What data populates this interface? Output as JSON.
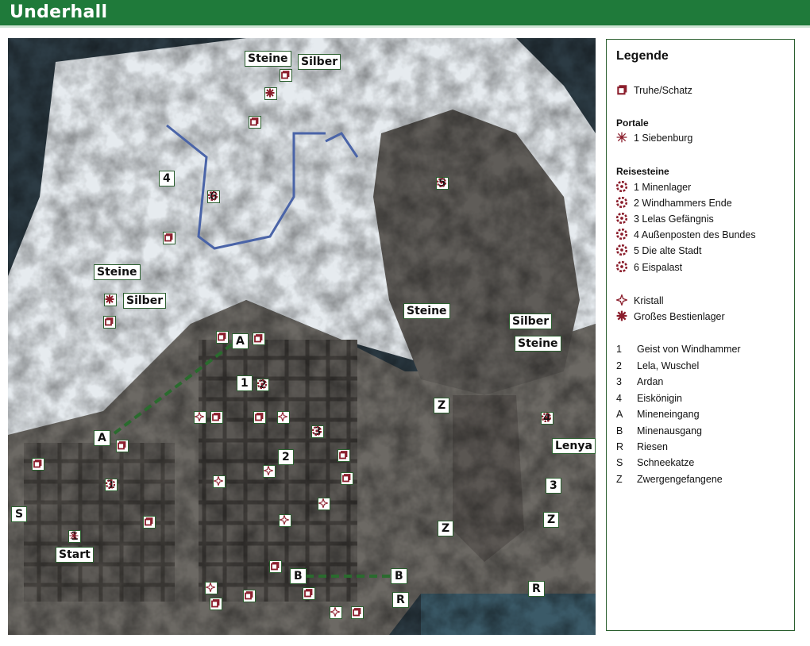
{
  "header": {
    "title": "Underhall"
  },
  "colors": {
    "title_bar": "#1f7a3a",
    "marker_red": "#8b1e2c",
    "border_green": "#2b5f2f",
    "path_green": "#2a6b2e"
  },
  "map": {
    "labels": {
      "steine_n": "Steine",
      "silber_n": "Silber",
      "steine_w": "Steine",
      "silber_w": "Silber",
      "steine_c": "Steine",
      "silber_e": "Silber",
      "steine_e": "Steine",
      "lenya": "Lenya",
      "start": "Start",
      "four": "4",
      "one": "1",
      "two": "2",
      "three": "3",
      "A1": "A",
      "A2": "A",
      "B1": "B",
      "B2": "B",
      "S": "S",
      "R1": "R",
      "R2": "R",
      "Z1": "Z",
      "Z2": "Z",
      "Z3": "Z"
    },
    "stones": {
      "s1": "1",
      "s2": "2",
      "s3": "3",
      "s4": "4",
      "s5": "5",
      "s6": "6"
    },
    "portal": {
      "p1": "1"
    }
  },
  "legend": {
    "title": "Legende",
    "chest": "Truhe/Schatz",
    "portals_heading": "Portale",
    "portal_1": "1 Siebenburg",
    "stones_heading": "Reisesteine",
    "stone_1": "1 Minenlager",
    "stone_2": "2 Windhammers Ende",
    "stone_3": "3 Lelas Gefängnis",
    "stone_4": "4 Außenposten des Bundes",
    "stone_5": "5 Die alte Stadt",
    "stone_6": "6 Eispalast",
    "crystal": "Kristall",
    "beast_camp": "Großes Bestienlager",
    "keys": [
      {
        "k": "1",
        "v": "Geist von Windhammer"
      },
      {
        "k": "2",
        "v": "Lela, Wuschel"
      },
      {
        "k": "3",
        "v": "Ardan"
      },
      {
        "k": "4",
        "v": "Eiskönigin"
      },
      {
        "k": "A",
        "v": "Mineneingang"
      },
      {
        "k": "B",
        "v": "Minenausgang"
      },
      {
        "k": "R",
        "v": "Riesen"
      },
      {
        "k": "S",
        "v": "Schneekatze"
      },
      {
        "k": "Z",
        "v": "Zwergengefangene"
      }
    ]
  }
}
